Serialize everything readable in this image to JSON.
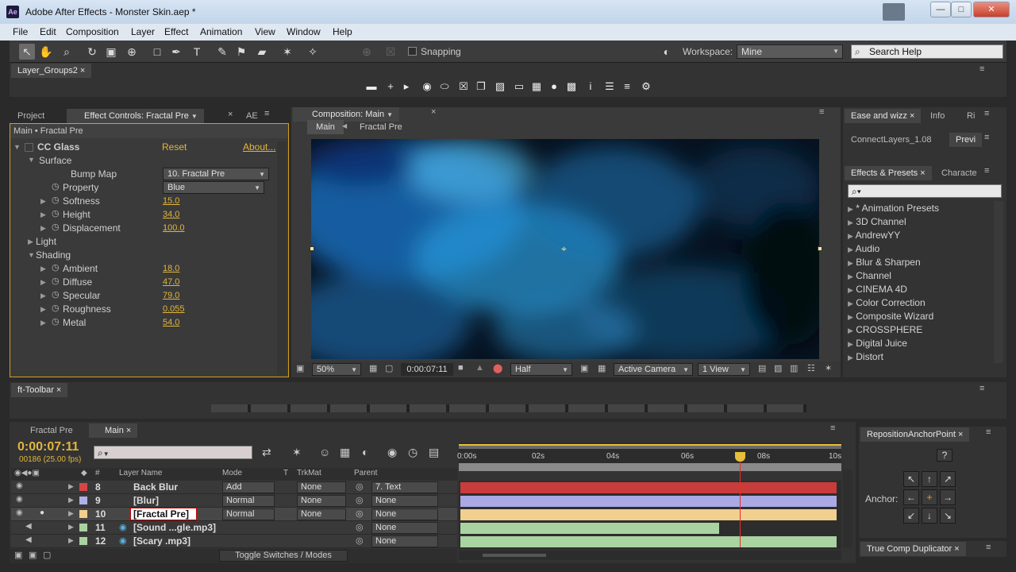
{
  "window": {
    "title": "Adobe After Effects - Monster Skin.aep *",
    "logo": "Ae",
    "controls": [
      "—",
      "□",
      "✕"
    ]
  },
  "menu": [
    "File",
    "Edit",
    "Composition",
    "Layer",
    "Effect",
    "Animation",
    "View",
    "Window",
    "Help"
  ],
  "toolbar": {
    "snapping": "Snapping",
    "workspace_label": "Workspace:",
    "workspace_value": "Mine",
    "search_placeholder": "Search Help"
  },
  "layer_groups": {
    "tab": "Layer_Groups2"
  },
  "effect_panel": {
    "tabs": [
      "Project",
      "Effect Controls: Fractal Pre",
      "AE"
    ],
    "breadcrumb": "Main • Fractal Pre",
    "effect": "CC Glass",
    "reset": "Reset",
    "about": "About...",
    "surface": "Surface",
    "bump_map_label": "Bump Map",
    "bump_map_value": "10. Fractal Pre",
    "property_label": "Property",
    "property_value": "Blue",
    "softness_label": "Softness",
    "softness_value": "15.0",
    "height_label": "Height",
    "height_value": "34.0",
    "displacement_label": "Displacement",
    "displacement_value": "100.0",
    "light": "Light",
    "shading": "Shading",
    "ambient_label": "Ambient",
    "ambient_value": "18.0",
    "diffuse_label": "Diffuse",
    "diffuse_value": "47.0",
    "specular_label": "Specular",
    "specular_value": "79.0",
    "roughness_label": "Roughness",
    "roughness_value": "0.055",
    "metal_label": "Metal",
    "metal_value": "54.0"
  },
  "comp_panel": {
    "tab": "Composition: Main",
    "crumb_main": "Main",
    "crumb_sub": "Fractal Pre",
    "zoom": "50%",
    "timecode": "0:00:07:11",
    "resolution": "Half",
    "camera": "Active Camera",
    "views": "1 View"
  },
  "right_panels": {
    "tabs_top": [
      "Ease and wizz",
      "Info",
      "Ri"
    ],
    "tabs_mid": [
      "ConnectLayers_1.08",
      "Previ"
    ],
    "tabs_fx": [
      "Effects & Presets",
      "Characte"
    ],
    "search_placeholder": "⌕▾",
    "items": [
      "* Animation Presets",
      "3D Channel",
      "AndrewYY",
      "Audio",
      "Blur & Sharpen",
      "Channel",
      "CINEMA 4D",
      "Color Correction",
      "Composite Wizard",
      "CROSSPHERE",
      "Digital Juice",
      "Distort"
    ]
  },
  "ft_toolbar": {
    "tab": "ft-Toolbar"
  },
  "timeline": {
    "tabs": [
      "Fractal Pre",
      "Main"
    ],
    "timecode": "0:00:07:11",
    "fps": "00186 (25.00 fps)",
    "cols": {
      "layer_name": "Layer Name",
      "mode": "Mode",
      "t": "T",
      "trkmat": "TrkMat",
      "parent": "Parent",
      "num": "#"
    },
    "ruler": [
      "0:00s",
      "02s",
      "04s",
      "06s",
      "08s",
      "10s"
    ],
    "layers": [
      {
        "num": "8",
        "name": "Back Blur",
        "mode": "Add",
        "trk": "None",
        "parent": "7. Text",
        "color": "#d64545"
      },
      {
        "num": "9",
        "name": "[Blur]",
        "mode": "Normal",
        "trk": "None",
        "parent": "None",
        "color": "#b0b0e8"
      },
      {
        "num": "10",
        "name": "[Fractal Pre]",
        "mode": "Normal",
        "trk": "None",
        "parent": "None",
        "color": "#f1cf8f"
      },
      {
        "num": "11",
        "name": "[Sound ...gle.mp3]",
        "mode": "",
        "trk": "",
        "parent": "None",
        "color": "#a9d3a1"
      },
      {
        "num": "12",
        "name": "[Scary .mp3]",
        "mode": "",
        "trk": "",
        "parent": "None",
        "color": "#a9d3a1"
      }
    ],
    "toggle": "Toggle Switches / Modes"
  },
  "anchor_panel": {
    "tab": "RepositionAnchorPoint",
    "label": "Anchor:",
    "help": "?",
    "bottom_tab": "True Comp Duplicator"
  }
}
